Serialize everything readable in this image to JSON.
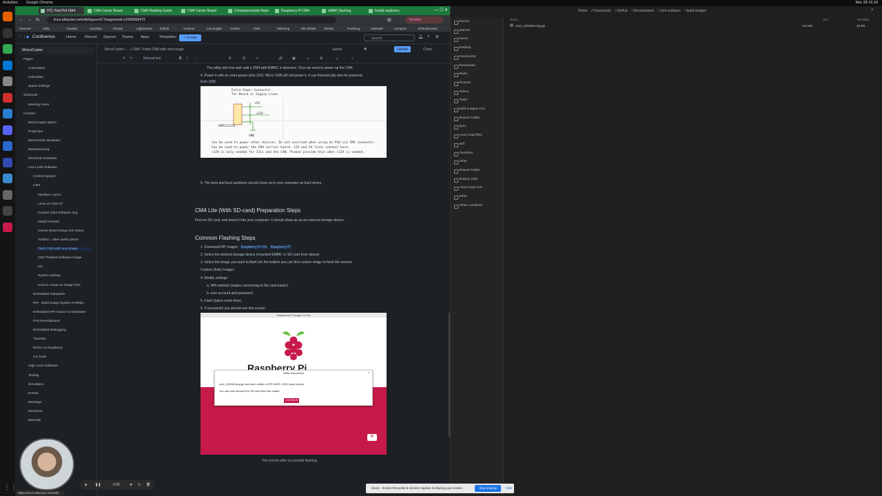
{
  "system": {
    "activities": "Activities",
    "app": "Google Chrome",
    "clock": "Mar 28 16:18"
  },
  "dock": {
    "icons": [
      {
        "name": "firefox-icon",
        "color": "#e66000"
      },
      {
        "name": "terminal-icon",
        "color": "#333333"
      },
      {
        "name": "chrome-icon",
        "color": "#34a853"
      },
      {
        "name": "vscode-icon",
        "color": "#0078d4"
      },
      {
        "name": "files-icon",
        "color": "#888888"
      },
      {
        "name": "video-icon",
        "color": "#d03030"
      },
      {
        "name": "network-icon",
        "color": "#2a7fd0"
      },
      {
        "name": "discord-icon",
        "color": "#5865f2"
      },
      {
        "name": "package-icon",
        "color": "#2a6ad0"
      },
      {
        "name": "kicad-icon",
        "color": "#314cb0"
      },
      {
        "name": "maps-icon",
        "color": "#3a8ad0"
      },
      {
        "name": "drive-icon",
        "color": "#666666"
      },
      {
        "name": "storage-icon",
        "color": "#444444"
      },
      {
        "name": "raspberry-icon",
        "color": "#c51a4a"
      }
    ]
  },
  "browser": {
    "tabs": [
      "HTL Pool Pi4 CM4",
      "CM4 Carrier Board",
      "CM4 Flashing Guide",
      "CM4 Carrier Board",
      "Computemodule Repo",
      "Raspberry Pi CM4",
      "eMMC flashing",
      "Install raspberry"
    ],
    "url": "ticos.atlassian.net/wiki/spaces/CT/pages/edit-v2/268009473",
    "profile": "Ricardo",
    "bookmarks": [
      "Summer",
      "Hallo",
      "Youtube",
      "Hausbau",
      "GitHub",
      "Lightweeee",
      "Github",
      "Amazon",
      "Lavurtoglie",
      "Hacker",
      "Klub",
      "Messung",
      "Alle Skripts",
      "GitHub",
      "Pruefung",
      "Kalender",
      "Lernpool",
      "All Bookmarks"
    ]
  },
  "confluence": {
    "logo": "Confluence",
    "nav": [
      "Home",
      "Recent",
      "Spaces",
      "Teams",
      "Apps",
      "Templates"
    ],
    "create": "+ Create",
    "search_placeholder": "Search",
    "space_name": "MonoCopter",
    "breadcrumb": "MonoCopter / ... / CM4 / Flash CM4 with new image",
    "saved": "Saved",
    "update": "Update",
    "close": "Close",
    "toolbar": {
      "text_style": "Normal text",
      "bold": "B",
      "italic": "I",
      "more": "···"
    }
  },
  "sidebar": {
    "items": [
      {
        "label": "Pages",
        "indent": 0
      },
      {
        "label": "Automation",
        "indent": 1
      },
      {
        "label": "Calendars",
        "indent": 1
      },
      {
        "label": "Space settings",
        "indent": 1
      },
      {
        "label": "Shortcuts",
        "indent": 0
      },
      {
        "label": "Meeting notes",
        "indent": 1
      },
      {
        "label": "Content",
        "indent": 0
      },
      {
        "label": "MonoCopter Specs",
        "indent": 1
      },
      {
        "label": "Projection",
        "indent": 1
      },
      {
        "label": "Mechanical Hardware",
        "indent": 1
      },
      {
        "label": "Manufacturing",
        "indent": 1
      },
      {
        "label": "Electrical Hardware",
        "indent": 1
      },
      {
        "label": "Low Level Software",
        "indent": 1
      },
      {
        "label": "Control System",
        "indent": 2
      },
      {
        "label": "CM4",
        "indent": 2
      },
      {
        "label": "Interface carrier",
        "indent": 3
      },
      {
        "label": "Linux on CM4 IO",
        "indent": 3
      },
      {
        "label": "Custom CM4 Software Img",
        "indent": 3
      },
      {
        "label": "Install Packets",
        "indent": 3
      },
      {
        "label": "Carrier Board Setup Unit Notes",
        "indent": 3
      },
      {
        "label": "Arduino - other tasks parser",
        "indent": 3
      },
      {
        "label": "Flash CM4 with new image",
        "indent": 3,
        "selected": true
      },
      {
        "label": "CM4 Flashed Software Image",
        "indent": 3
      },
      {
        "label": "I2C",
        "indent": 3
      },
      {
        "label": "System Startup",
        "indent": 3
      },
      {
        "label": "How to create an image from",
        "indent": 3
      },
      {
        "label": "Embedded Interpreter",
        "indent": 2
      },
      {
        "label": "RPI - Build Image System Portfolio",
        "indent": 2
      },
      {
        "label": "Embedded RPI Source to Hardware",
        "indent": 2
      },
      {
        "label": "PX4 Development",
        "indent": 2
      },
      {
        "label": "Embedded Debugging",
        "indent": 2
      },
      {
        "label": "Tutorials",
        "indent": 2
      },
      {
        "label": "ROS2 on Raspberry",
        "indent": 2
      },
      {
        "label": "CLI tools",
        "indent": 2
      },
      {
        "label": "High Level Software",
        "indent": 1
      },
      {
        "label": "Testing",
        "indent": 1
      },
      {
        "label": "Simulation",
        "indent": 1
      },
      {
        "label": "Events",
        "indent": 1
      },
      {
        "label": "Meetings",
        "indent": 1
      },
      {
        "label": "Decisions",
        "indent": 1
      },
      {
        "label": "Manuals",
        "indent": 1
      }
    ]
  },
  "doc": {
    "line1": "The utility will now wait until a CM4 with EMMC is detected. Thus we need to power up the CM4.",
    "line2a": "4. Power it with an extra power (min 12V). Micro USB will not power it, it can theoretically also be powered",
    "line2b": "from USB.",
    "schematic": {
      "title1": "Extra Power Connector",
      "title2": "for Board or Supply Lines",
      "v5": "+5V",
      "v12": "+12V",
      "part": "AMPS7232S",
      "gnd": "GND",
      "note1": "Can be used to power other devices. Do not overload when using an PSU via CM4 connector.",
      "note2": "Can be used to power the CM4 carrier board. 12V and 5V lines connect here.",
      "note3": "+12V is only needed for I2Cs and the CAN. Please provide this when +12V is needed."
    },
    "line3": "5. The boot and boot partitions should show up in your computer as hard drives.",
    "h_cm4lite": "CM4 Lite (With SD-card) Preparation Steps",
    "cm4lite_text": "Find an SD card, and insert it into your computer. It should show up as an external storage device.",
    "h_common": "Common Flashing Steps",
    "step1_prefix": "1. Download RPi imager:",
    "step1_link": "Raspberry Pi OS",
    "step1_link2": "Raspberry Pi",
    "step2": "2. Select the desired storage device (mounted EMMC or SD-card from above)",
    "step3a": "3. Select the image you want to flash (on the bottom you can find custom image to flash the newest",
    "step3b": "Custom Distro Image)",
    "step4": "4. Modify settings:",
    "step4a": "a. Wifi network (makes connecting to the card easier)",
    "step4b": "b. user account and password",
    "step5": "5. Flash (takes some time)",
    "step6": "6. If successful you should see this screen:",
    "imager": {
      "window_title": "Raspberry Pi Imager v1.8.5",
      "brand": "Raspberry Pi",
      "dialog_title": "Write Successful",
      "dialog_text1": "cm4_240304.img.gz has been written to RPI-MSD- 0001 (boot,rootfs)",
      "dialog_text2": "You can now remove the SD card from the reader",
      "continue": "CONTINUE"
    },
    "caption": "The screen after successful flashing"
  },
  "files": {
    "path": [
      "Home",
      "Documents",
      "GitHub",
      "Development",
      "cm4-software",
      "build-images"
    ],
    "places": [
      "Recent",
      "Starred",
      "Home",
      "Desktop",
      "Documents",
      "Downloads",
      "Music",
      "Pictures",
      "Videos",
      "Trash",
      "build-images-cm4",
      "Shared Folder",
      "Sync",
      "Linux-raspi-files",
      "eeff",
      "OneDrive",
      "Other",
      "Shared Folder",
      "Shared_Disk",
      "Linux-raspi-root",
      "Other",
      "Other Locations"
    ],
    "col_name": "Name",
    "col_size": "Size",
    "col_modified": "Modified",
    "file_name": "cm4_240304.img.gz",
    "file_size": "4.0 GB",
    "file_modified": "12:08"
  },
  "recorder": {
    "time": "0:00"
  },
  "statusbar": {
    "url": "https://ticos.atlassian.net/wiki/..."
  },
  "share": {
    "text": "Zoom - Screen Recorder & Screen Capture is sharing your screen.",
    "stop": "Stop sharing",
    "hide": "Hide"
  }
}
